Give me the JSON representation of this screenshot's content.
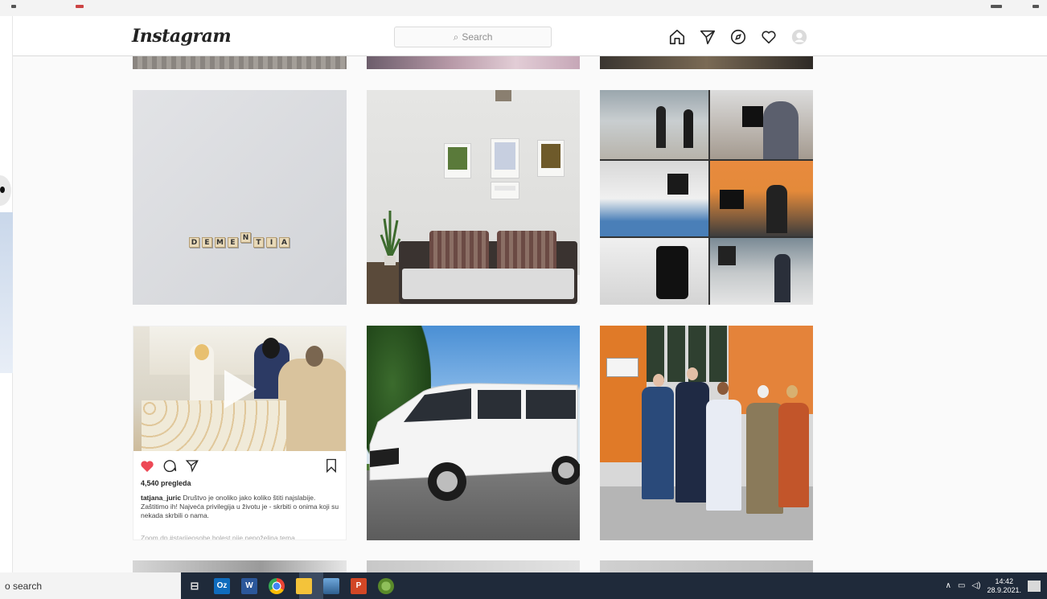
{
  "header": {
    "logo": "Instagram",
    "search_placeholder": "Search"
  },
  "nav": {
    "icons": [
      "home-icon",
      "direct-icon",
      "explore-icon",
      "activity-icon",
      "profile-icon"
    ]
  },
  "posts": {
    "dementia_letters": [
      "D",
      "E",
      "M",
      "E",
      "N",
      "T",
      "I",
      "A"
    ],
    "video_post": {
      "views": "4,540 pregleda",
      "username": "tatjana_juric",
      "caption": "Društvo je onoliko jako koliko štiti najslabije. Zaštitimo ih! Najveća privilegija u životu je - skrbiti o onima koji su nekada skrbili o nama.",
      "caption_more": "Zoom.dp.#starijeosobe.bolest.nije.nepoželjna.tema"
    }
  },
  "taskbar": {
    "search_text": "o search",
    "apps": [
      {
        "name": "task-view",
        "label": "⊟"
      },
      {
        "name": "outlook",
        "label": "Oz"
      },
      {
        "name": "word",
        "label": "W"
      },
      {
        "name": "chrome",
        "label": ""
      },
      {
        "name": "file-explorer",
        "label": ""
      },
      {
        "name": "photos",
        "label": ""
      },
      {
        "name": "powerpoint",
        "label": "P"
      },
      {
        "name": "paint",
        "label": ""
      }
    ],
    "time": "14:42",
    "date": "28.9.2021."
  },
  "colors": {
    "like_red": "#ed4956",
    "taskbar_bg": "#1f2a3a"
  }
}
